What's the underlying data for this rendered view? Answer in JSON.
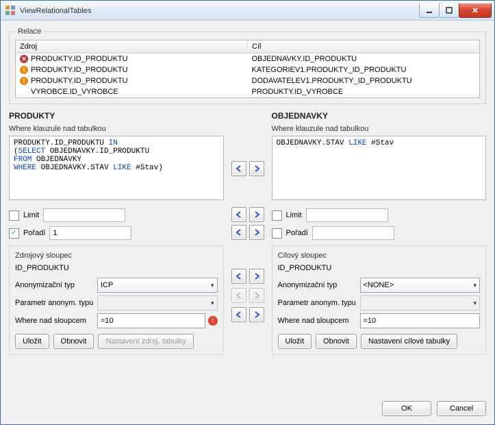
{
  "window": {
    "title": "ViewRelationalTables"
  },
  "relace": {
    "legend": "Relace",
    "columns": {
      "source": "Zdroj",
      "target": "Cíl"
    },
    "rows": [
      {
        "icon": "x",
        "source": "PRODUKTY.ID_PRODUKTU",
        "target": "OBJEDNAVKY.ID_PRODUKTU"
      },
      {
        "icon": "bang",
        "source": "PRODUKTY.ID_PRODUKTU",
        "target": "KATEGORIEV1.PRODUKTY_ID_PRODUKTU"
      },
      {
        "icon": "bang",
        "source": "PRODUKTY.ID_PRODUKTU",
        "target": "DODAVATELEV1.PRODUKTY_ID_PRODUKTU"
      },
      {
        "icon": "none",
        "source": "VYROBCE.ID_VYROBCE",
        "target": "PRODUKTY.ID_VYROBCE"
      }
    ]
  },
  "left": {
    "title": "PRODUKTY",
    "where_label": "Where klauzule nad tabulkou",
    "where_html": "PRODUKTY.ID_PRODUKTU <span class=\"kw\">IN</span>\n(<span class=\"kw\">SELECT</span> OBJEDNAVKY.ID_PRODUKTU\n<span class=\"kw\">FROM</span> OBJEDNAVKY\n<span class=\"kw\">WHERE</span> OBJEDNAVKY.STAV <span class=\"kw\">LIKE</span> #Stav)",
    "limit_label": "Limit",
    "limit_checked": false,
    "limit_value": "",
    "order_label": "Pořadí",
    "order_checked": true,
    "order_value": "1",
    "group_title": "Zdrojový sloupec",
    "col_value": "ID_PRODUKTU",
    "anon_type_label": "Anonymizační typ",
    "anon_type_value": "ICP",
    "anon_param_label": "Parametr anonym. typu",
    "anon_param_value": "",
    "where_col_label": "Where nad sloupcem",
    "where_col_value": "=10",
    "buttons": {
      "save": "Uložit",
      "refresh": "Obnovit",
      "settings": "Nastavení zdroj. tabulky"
    }
  },
  "right": {
    "title": "OBJEDNAVKY",
    "where_label": "Where klauzule nad tabulkou",
    "where_html": "OBJEDNAVKY.STAV <span class=\"kw\">LIKE</span> #Stav",
    "limit_label": "Limit",
    "limit_checked": false,
    "limit_value": "",
    "order_label": "Pořadí",
    "order_checked": false,
    "order_value": "",
    "group_title": "Cílový sloupec",
    "col_value": "ID_PRODUKTU",
    "anon_type_label": "Anonymizační typ",
    "anon_type_value": "<NONE>",
    "anon_param_label": "Parametr anonym. typu",
    "anon_param_value": "",
    "where_col_label": "Where nad sloupcem",
    "where_col_value": "=10",
    "buttons": {
      "save": "Uložit",
      "refresh": "Obnovit",
      "settings": "Nastavení cílové tabulky"
    }
  },
  "footer": {
    "ok": "OK",
    "cancel": "Cancel"
  }
}
